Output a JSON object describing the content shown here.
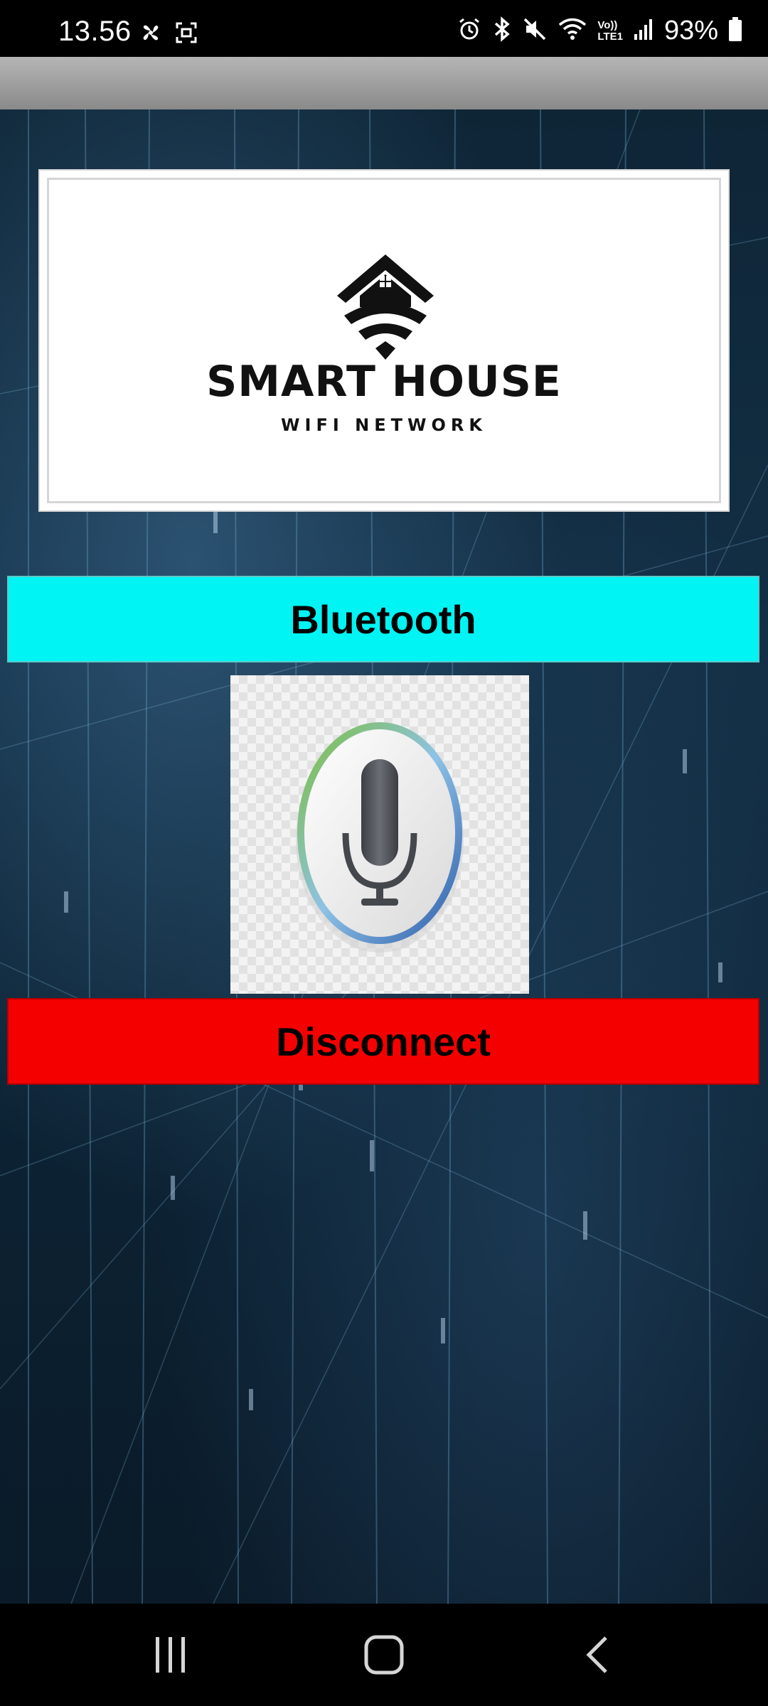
{
  "status_bar": {
    "time": "13.56",
    "battery": "93%",
    "icons": [
      "pinwheel-icon",
      "screenshot-icon",
      "alarm-icon",
      "bluetooth-icon",
      "mute-icon",
      "wifi-icon",
      "volte-lte-icon",
      "signal-icon",
      "battery-icon"
    ],
    "volte_label": "Vo))",
    "lte_label": "LTE1"
  },
  "logo": {
    "title": "SMART HOUSE",
    "subtitle": "WIFI NETWORK"
  },
  "buttons": {
    "bluetooth_label": "Bluetooth",
    "disconnect_label": "Disconnect"
  },
  "voice": {
    "icon": "microphone-icon"
  },
  "nav": {
    "recents": "recents-icon",
    "home": "home-icon",
    "back": "back-icon"
  },
  "colors": {
    "bluetooth_button": "#00f4f4",
    "disconnect_button": "#f50000",
    "status_bar": "#000000",
    "app_bar": "#a0a0a0",
    "background": "#0e2536"
  }
}
